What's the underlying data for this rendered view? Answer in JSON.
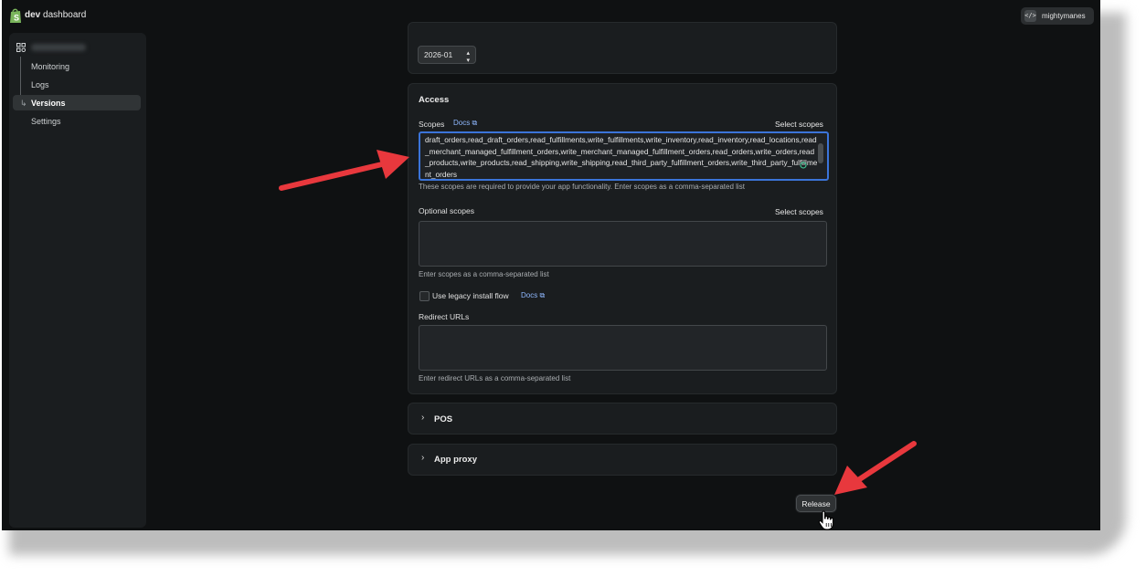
{
  "topbar": {
    "brand_bold": "dev",
    "brand_rest": " dashboard",
    "username": "mightymanes",
    "code_icon": "</>"
  },
  "sidebar": {
    "items": [
      {
        "label": "Monitoring"
      },
      {
        "label": "Logs"
      },
      {
        "label": "Versions",
        "active": true
      },
      {
        "label": "Settings"
      }
    ]
  },
  "webhooks": {
    "version_value": "2026-01",
    "select_icon": "chevron-up-down-icon"
  },
  "access": {
    "title": "Access",
    "scopes_label": "Scopes",
    "docs_label": "Docs",
    "select_scopes_label": "Select scopes",
    "scopes_value": "draft_orders,read_draft_orders,read_fulfillments,write_fulfillments,write_inventory,read_inventory,read_locations,read_merchant_managed_fulfillment_orders,write_merchant_managed_fulfillment_orders,read_orders,write_orders,read_products,write_products,read_shipping,write_shipping,read_third_party_fulfillment_orders,write_third_party_fulfillment_orders",
    "scopes_help": "These scopes are required to provide your app functionality. Enter scopes as a comma-separated list",
    "optional_label": "Optional scopes",
    "optional_select_label": "Select scopes",
    "optional_help": "Enter scopes as a comma-separated list",
    "legacy_label": "Use legacy install flow",
    "legacy_docs": "Docs",
    "redirect_label": "Redirect URLs",
    "redirect_help": "Enter redirect URLs as a comma-separated list"
  },
  "pos": {
    "title": "POS"
  },
  "app_proxy": {
    "title": "App proxy"
  },
  "actions": {
    "release_label": "Release"
  },
  "colors": {
    "accent_blue": "#3b74d9",
    "link_blue": "#8fb8ff",
    "annotation_red": "#e8383d"
  }
}
